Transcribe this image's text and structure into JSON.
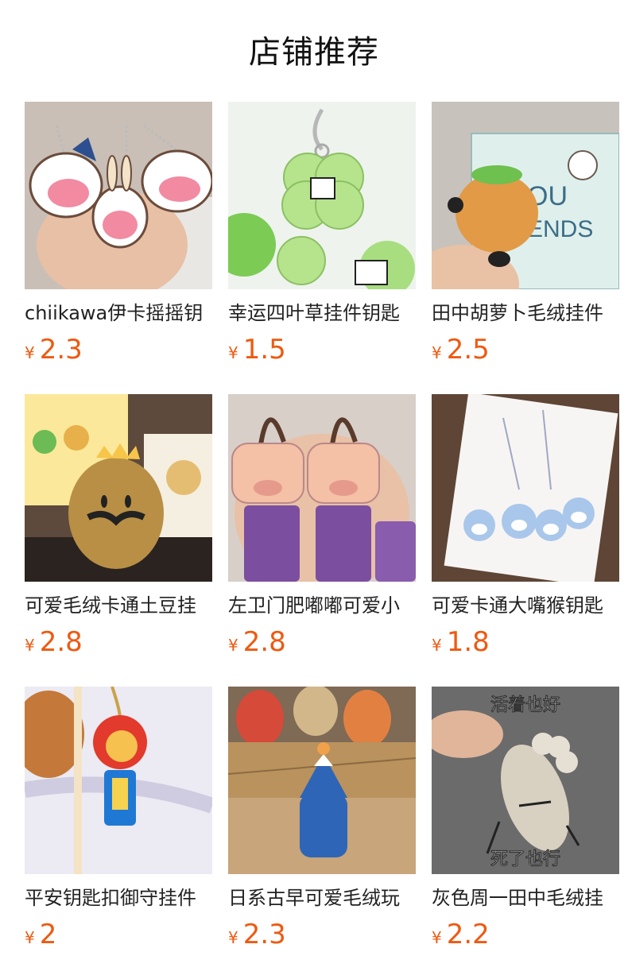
{
  "header": {
    "title": "店铺推荐"
  },
  "currency_symbol": "¥",
  "colors": {
    "price": "#ee5a11",
    "title": "#111111"
  },
  "products": [
    {
      "name": "chiikawa伊卡摇摇钥",
      "price": "2.3",
      "image_icon": "chiikawa-keychain-photo"
    },
    {
      "name": "幸运四叶草挂件钥匙",
      "price": "1.5",
      "image_icon": "clover-keychain-photo"
    },
    {
      "name": "田中胡萝卜毛绒挂件",
      "price": "2.5",
      "image_icon": "carrot-plush-photo"
    },
    {
      "name": "可爱毛绒卡通土豆挂",
      "price": "2.8",
      "image_icon": "potato-plush-photo"
    },
    {
      "name": "左卫门肥嘟嘟可爱小",
      "price": "2.8",
      "image_icon": "pig-charm-photo"
    },
    {
      "name": "可爱卡通大嘴猴钥匙",
      "price": "1.8",
      "image_icon": "monkey-keychain-photo"
    },
    {
      "name": "平安钥匙扣御守挂件",
      "price": "2",
      "image_icon": "omamori-keychain-photo"
    },
    {
      "name": "日系古早可爱毛绒玩",
      "price": "2.3",
      "image_icon": "fuji-plush-photo"
    },
    {
      "name": "灰色周一田中毛绒挂",
      "price": "2.2",
      "image_icon": "radish-plush-photo"
    }
  ],
  "image_captions": {
    "radish_top": "活着也好",
    "radish_bottom": "死了也行"
  }
}
